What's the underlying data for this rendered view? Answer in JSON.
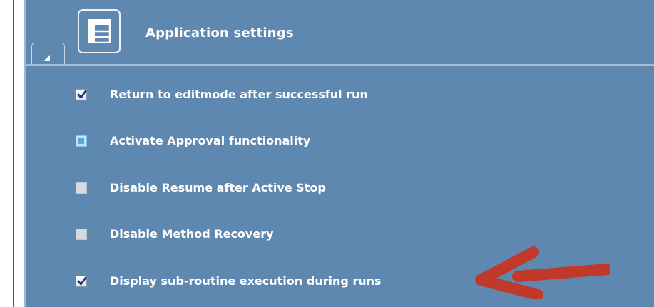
{
  "panel": {
    "title": "Application settings",
    "app_icon": "layout-grid-icon",
    "collapse_icon": "collapse-triangle-icon"
  },
  "settings": [
    {
      "label": "Return to editmode after successful run",
      "checked": true
    },
    {
      "label": "Activate Approval functionality",
      "checked": false,
      "state": "focused"
    },
    {
      "label": "Disable Resume after Active Stop",
      "checked": false
    },
    {
      "label": "Disable Method Recovery",
      "checked": false
    },
    {
      "label": "Display sub-routine execution during runs",
      "checked": true
    }
  ],
  "annotation": {
    "arrow_icon": "red-arrow-left-icon",
    "arrow_color": "#c0392b",
    "points_to": "settings.4"
  },
  "colors": {
    "panel_bg": "#5f88b0",
    "text": "#ffffff",
    "checkmark": "#1f2f6b"
  }
}
